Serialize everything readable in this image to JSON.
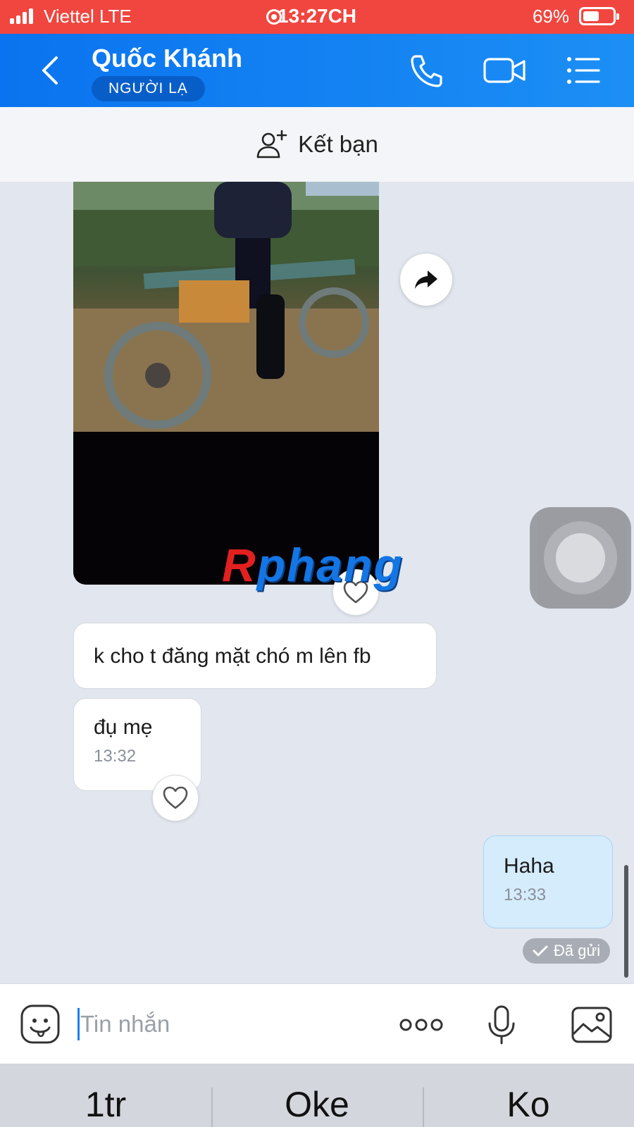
{
  "status_bar": {
    "carrier": "Viettel LTE",
    "time": "13:27CH",
    "battery": "69%"
  },
  "header": {
    "contact_name": "Quốc Khánh",
    "badge": "NGƯỜI LẠ"
  },
  "add_friend": {
    "label": "Kết bạn"
  },
  "watermark": {
    "first": "R",
    "rest": "phang"
  },
  "messages": [
    {
      "text": "k cho t đăng mặt chó m lên fb",
      "time": ""
    },
    {
      "text": "đụ mẹ",
      "time": "13:32"
    },
    {
      "text": "Haha",
      "time": "13:33",
      "status": "Đã gửi"
    }
  ],
  "composer": {
    "placeholder": "Tin nhắn"
  },
  "quick_replies": [
    "1tr",
    "Oke",
    "Ko"
  ],
  "colors": {
    "status_bar": "#f0463f",
    "header": "#0a73ef",
    "sent_bubble": "#d5ecfd",
    "chat_bg": "#e2e6ee"
  }
}
